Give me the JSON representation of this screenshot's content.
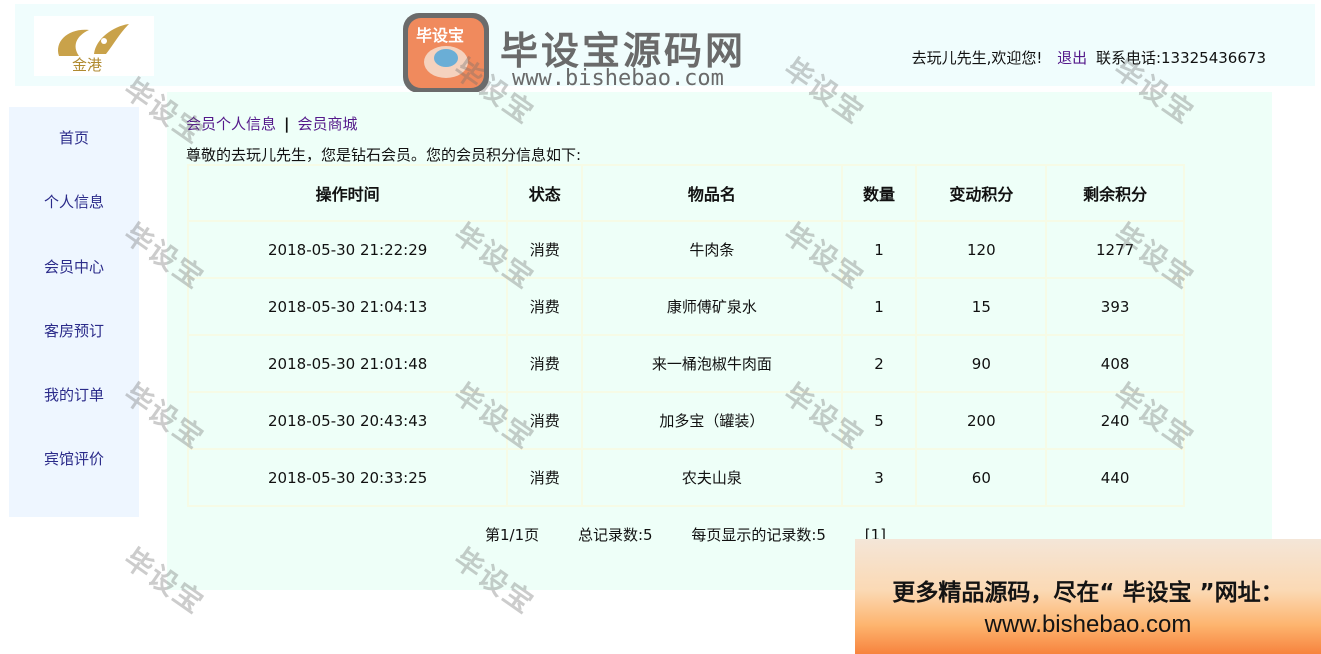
{
  "header": {
    "logo_text": "金港",
    "brand_badge": "毕设宝",
    "brand_title": "毕设宝源码网",
    "brand_url": "www.bishebao.com",
    "welcome": "去玩儿先生,欢迎您!",
    "logout": "退出",
    "contact": "联系电话:13325436673"
  },
  "sidebar": {
    "items": [
      "首页",
      "个人信息",
      "会员中心",
      "客房预订",
      "我的订单",
      "宾馆评价"
    ]
  },
  "content": {
    "tabs": [
      "会员个人信息",
      "会员商城"
    ],
    "tab_separator": "|",
    "greeting": "尊敬的去玩儿先生，您是钻石会员。您的会员积分信息如下:",
    "table": {
      "headers": [
        "操作时间",
        "状态",
        "物品名",
        "数量",
        "变动积分",
        "剩余积分"
      ],
      "rows": [
        [
          "2018-05-30 21:22:29",
          "消费",
          "牛肉条",
          "1",
          "120",
          "1277"
        ],
        [
          "2018-05-30 21:04:13",
          "消费",
          "康师傅矿泉水",
          "1",
          "15",
          "393"
        ],
        [
          "2018-05-30 21:01:48",
          "消费",
          "来一桶泡椒牛肉面",
          "2",
          "90",
          "408"
        ],
        [
          "2018-05-30 20:43:43",
          "消费",
          "加多宝（罐装）",
          "5",
          "200",
          "240"
        ],
        [
          "2018-05-30 20:33:25",
          "消费",
          "农夫山泉",
          "3",
          "60",
          "440"
        ]
      ]
    },
    "pager": {
      "page": "第1/1页",
      "total": "总记录数:5",
      "per_page": "每页显示的记录数:5",
      "page_link": "[1]"
    }
  },
  "watermark": "毕设宝",
  "ad": {
    "line1": "更多精品源码，尽在“ 毕设宝 ”网址：",
    "line2": "www.bishebao.com"
  },
  "colors": {
    "header_bg": "#f0fdfd",
    "sidebar_bg": "#eef6ff",
    "content_bg": "#eefff8",
    "link": "#551a8b",
    "badge_orange": "#f08a5d"
  }
}
